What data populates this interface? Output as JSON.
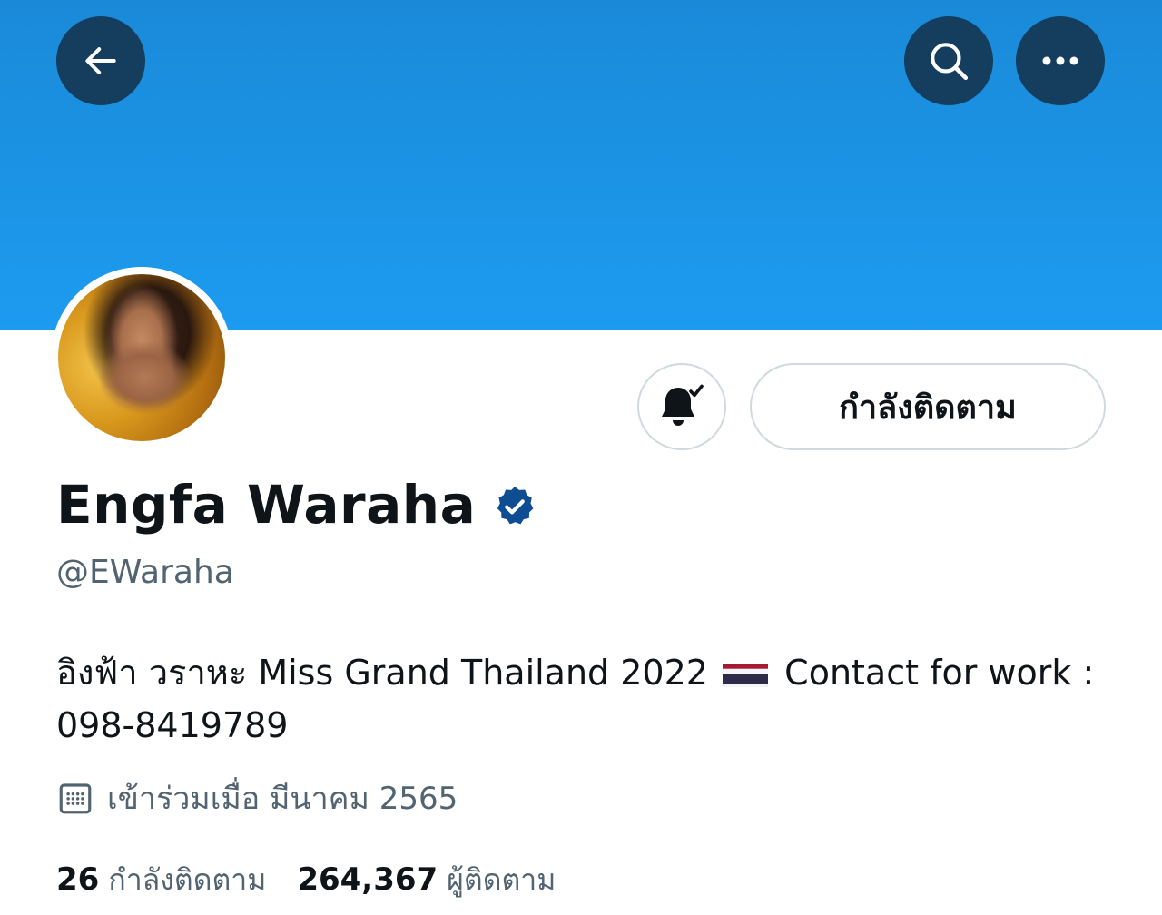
{
  "header": {
    "back_icon": "arrow-left-icon",
    "search_icon": "search-icon",
    "more_icon": "more-horizontal-icon",
    "banner_color": "#1d9bf0",
    "button_bg": "#143d5e"
  },
  "profile": {
    "display_name": "Engfa Waraha",
    "verified_icon": "verified-badge-icon",
    "verified_color": "#0e4d92",
    "handle": "@EWaraha",
    "bio": "อิงฟ้า วราหะ Miss Grand Thailand 2022",
    "bio_after_flag": "Contact for work : 098-8419789",
    "flag_icon": "thailand-flag-icon",
    "joined_icon": "calendar-icon",
    "joined": "เข้าร่วมเมื่อ มีนาคม 2565"
  },
  "actions": {
    "notify_icon": "bell-check-icon",
    "following_label": "กำลังติดตาม"
  },
  "stats": {
    "following_count": "26",
    "following_label": "กำลังติดตาม",
    "followers_count": "264,367",
    "followers_label": "ผู้ติดตาม"
  }
}
